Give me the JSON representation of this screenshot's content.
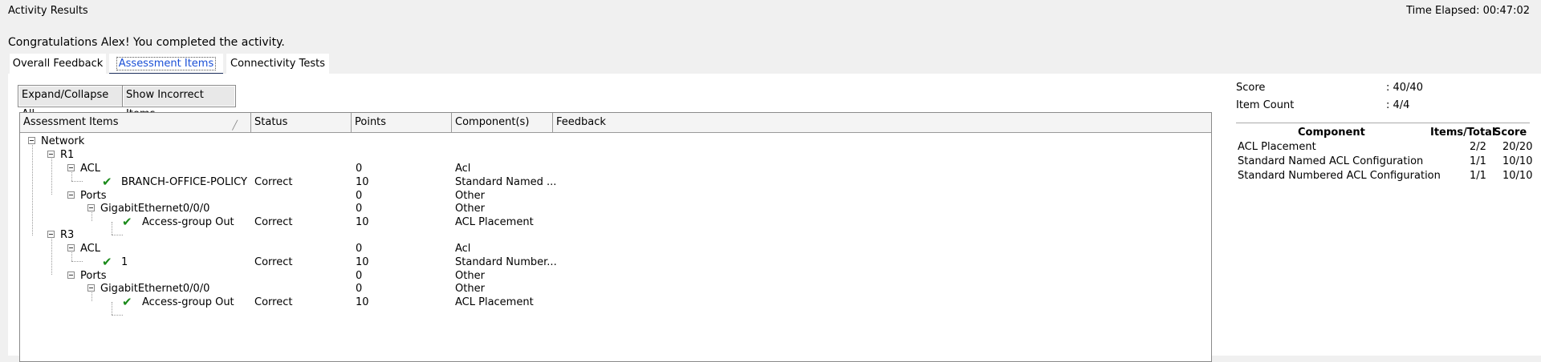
{
  "window": {
    "title": "Activity Results",
    "time_elapsed": "Time Elapsed: 00:47:02"
  },
  "message": "Congratulations Alex! You completed the activity.",
  "tabs": [
    {
      "label": "Overall Feedback",
      "active": false
    },
    {
      "label": "Assessment Items",
      "active": true
    },
    {
      "label": "Connectivity Tests",
      "active": false
    }
  ],
  "buttons": {
    "expand": "Expand/Collapse All",
    "show_incorrect": "Show Incorrect Items"
  },
  "columns": [
    "Assessment Items",
    "Status",
    "Points",
    "Component(s)",
    "Feedback"
  ],
  "tree": [
    {
      "name": "Network",
      "status": "",
      "points": "",
      "component": "",
      "feedback": ""
    },
    {
      "name": "R1",
      "status": "",
      "points": "",
      "component": "",
      "feedback": ""
    },
    {
      "name": "ACL",
      "status": "",
      "points": "0",
      "component": "Acl",
      "feedback": ""
    },
    {
      "name": "BRANCH-OFFICE-POLICY",
      "status": "Correct",
      "points": "10",
      "component": "Standard Named ...",
      "feedback": ""
    },
    {
      "name": "Ports",
      "status": "",
      "points": "0",
      "component": "Other",
      "feedback": ""
    },
    {
      "name": "GigabitEthernet0/0/0",
      "status": "",
      "points": "0",
      "component": "Other",
      "feedback": ""
    },
    {
      "name": "Access-group Out",
      "status": "Correct",
      "points": "10",
      "component": "ACL Placement",
      "feedback": ""
    },
    {
      "name": "R3",
      "status": "",
      "points": "",
      "component": "",
      "feedback": ""
    },
    {
      "name": "ACL",
      "status": "",
      "points": "0",
      "component": "Acl",
      "feedback": ""
    },
    {
      "name": "1",
      "status": "Correct",
      "points": "10",
      "component": "Standard Number...",
      "feedback": ""
    },
    {
      "name": "Ports",
      "status": "",
      "points": "0",
      "component": "Other",
      "feedback": ""
    },
    {
      "name": "GigabitEthernet0/0/0",
      "status": "",
      "points": "0",
      "component": "Other",
      "feedback": ""
    },
    {
      "name": "Access-group Out",
      "status": "Correct",
      "points": "10",
      "component": "ACL Placement",
      "feedback": ""
    }
  ],
  "summary": {
    "score_label": "Score",
    "score_value": ": 40/40",
    "count_label": "Item Count",
    "count_value": ": 4/4",
    "headers": {
      "component": "Component",
      "items": "Items/Total",
      "score": "Score"
    },
    "rows": [
      {
        "component": "ACL Placement",
        "items": "2/2",
        "score": "20/20"
      },
      {
        "component": "Standard Named ACL Configuration",
        "items": "1/1",
        "score": "10/10"
      },
      {
        "component": "Standard Numbered ACL Configuration",
        "items": "1/1",
        "score": "10/10"
      }
    ]
  },
  "colors": {
    "accent": "#1a2d5a",
    "check": "#1a8a1a",
    "link": "#1a4fd6"
  }
}
